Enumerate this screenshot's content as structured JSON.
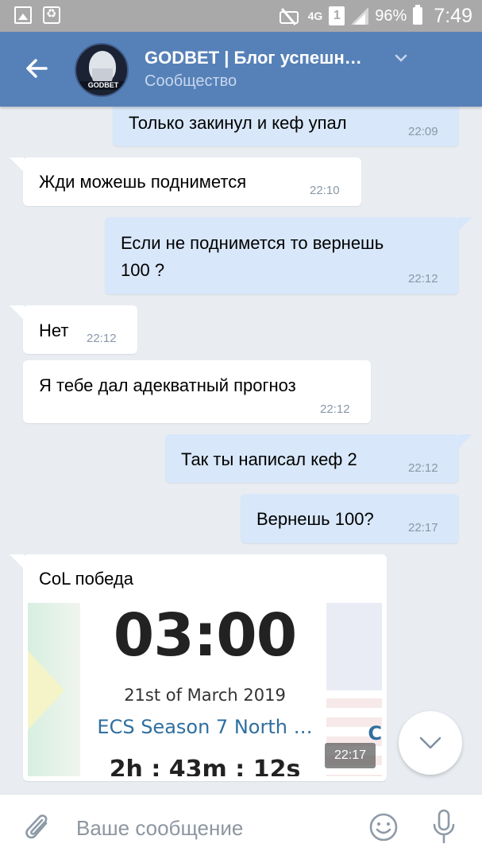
{
  "status_bar": {
    "signal_type": "4G",
    "sim": "1",
    "battery": "96%",
    "time": "7:49"
  },
  "header": {
    "title": "GODBET | Блог успешн…",
    "subtitle": "Сообщество",
    "avatar_label": "GODBET",
    "accent_color": "#5681b8"
  },
  "messages": [
    {
      "dir": "out",
      "text": "Только закинул и кеф упал",
      "time": "22:09"
    },
    {
      "dir": "in",
      "text": "Жди можешь поднимется",
      "time": "22:10"
    },
    {
      "dir": "out",
      "text_line1": "Если не поднимется то вернешь",
      "text_line2": "100 ?",
      "time": "22:12"
    },
    {
      "dir": "in",
      "text": "Нет",
      "time": "22:12"
    },
    {
      "dir": "in",
      "text": "Я тебе дал адекватный прогноз",
      "time": "22:12"
    },
    {
      "dir": "out",
      "text": "Так ты написал кеф 2",
      "time": "22:12"
    },
    {
      "dir": "out",
      "text": "Вернешь 100?",
      "time": "22:17"
    },
    {
      "dir": "in",
      "text": "CoL победа",
      "time": "22:17"
    }
  ],
  "preview": {
    "big_time": "03:00",
    "date": "21st of March 2019",
    "event": "ECS Season 7 North …",
    "event_tail": "C",
    "countdown": "2h : 43m : 12s"
  },
  "input": {
    "placeholder": "Ваше сообщение"
  },
  "icons": {
    "back": "arrow-left-icon",
    "attach": "paperclip-icon",
    "emoji": "smile-icon",
    "mic": "microphone-icon",
    "scroll_down": "chevron-down-icon"
  }
}
